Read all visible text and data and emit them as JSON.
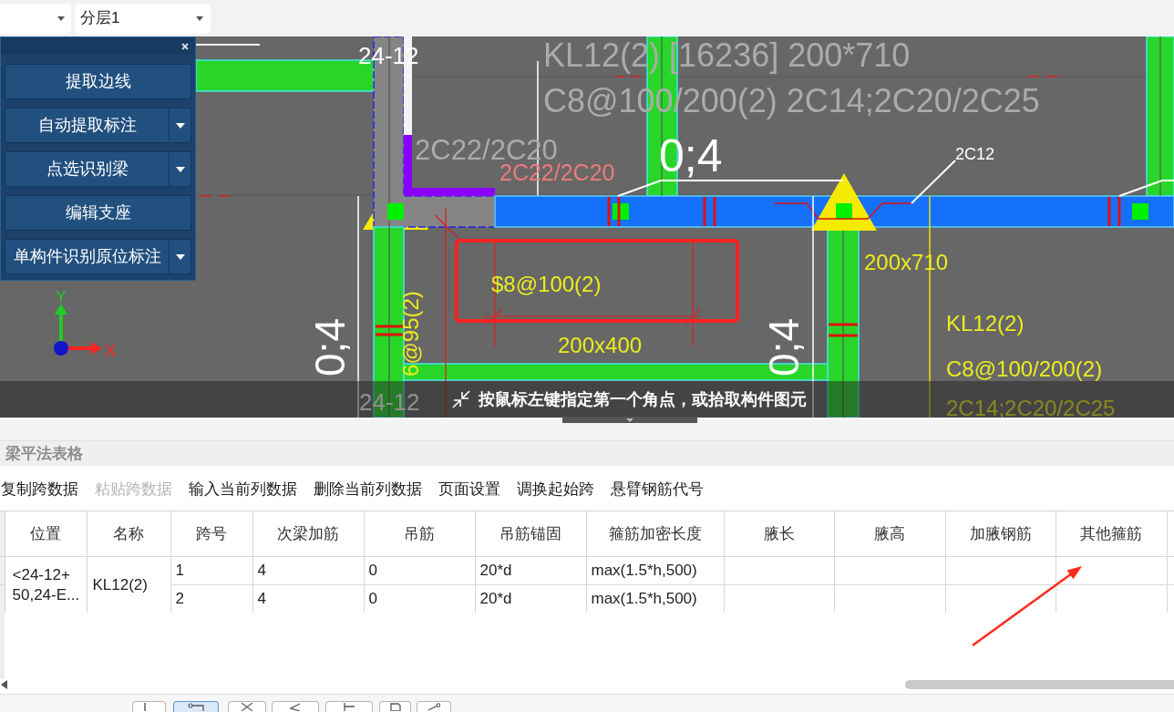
{
  "top_bar": {
    "layer_dropdown": "分层1"
  },
  "recognition_panel": {
    "buttons": [
      {
        "label": "提取边线",
        "has_menu": false
      },
      {
        "label": "自动提取标注",
        "has_menu": true
      },
      {
        "label": "点选识别梁",
        "has_menu": true
      },
      {
        "label": "编辑支座",
        "has_menu": false
      },
      {
        "label": "单构件识别原位标注",
        "has_menu": true
      }
    ]
  },
  "canvas": {
    "texts": [
      {
        "kind": "axis_number",
        "text": "24-12"
      },
      {
        "kind": "beam_spec",
        "text": "KL12(2) [16236] 200*710"
      },
      {
        "kind": "beam_spec",
        "text": "C8@100/200(2) 2C14;2C20/2C25"
      },
      {
        "kind": "rebar_spec",
        "text": "2C22/2C20"
      },
      {
        "kind": "span_mark",
        "text": "0;4"
      },
      {
        "kind": "leader_note",
        "text": "2C12"
      },
      {
        "kind": "rebar_mark",
        "text": "2C22/2C20"
      },
      {
        "kind": "cad_note",
        "text": "200x710"
      },
      {
        "kind": "cad_note",
        "text": "$8@100(2)"
      },
      {
        "kind": "cad_note_vertical",
        "text": "6@95(2)"
      },
      {
        "kind": "cad_note",
        "text": "KL12(2)"
      },
      {
        "kind": "span_mark_vertical",
        "text": "0;4"
      },
      {
        "kind": "cad_note",
        "text": "200x400"
      },
      {
        "kind": "span_mark_vertical",
        "text": "0;4"
      },
      {
        "kind": "cad_note",
        "text": "C8@100/200(2)"
      },
      {
        "kind": "axis_number",
        "text": "24-12"
      },
      {
        "kind": "cad_note",
        "text": "2C14;2C20/2C25"
      }
    ],
    "axis_indicator": {
      "x_label": "X",
      "y_label": "Y"
    }
  },
  "status_prompt": "按鼠标左键指定第一个角点，或拾取构件图元",
  "table_panel": {
    "title": "梁平法表格",
    "actions": [
      {
        "label": "复制跨数据",
        "disabled": false
      },
      {
        "label": "粘贴跨数据",
        "disabled": true
      },
      {
        "label": "输入当前列数据",
        "disabled": false
      },
      {
        "label": "删除当前列数据",
        "disabled": false
      },
      {
        "label": "页面设置",
        "disabled": false
      },
      {
        "label": "调换起始跨",
        "disabled": false
      },
      {
        "label": "悬臂钢筋代号",
        "disabled": false
      }
    ],
    "table": {
      "columns": [
        "位置",
        "名称",
        "跨号",
        "次梁加筋",
        "吊筋",
        "吊筋锚固",
        "箍筋加密长度",
        "腋长",
        "腋高",
        "加腋钢筋",
        "其他箍筋"
      ],
      "beams": [
        {
          "position_lines": [
            "<24-12+",
            "50,24-E..."
          ],
          "name": "KL12(2)",
          "spans": [
            [
              "1",
              "4",
              "0",
              "20*d",
              "max(1.5*h,500)"
            ],
            [
              "2",
              "4",
              "0",
              "20*d",
              "max(1.5*h,500)"
            ]
          ]
        }
      ]
    }
  },
  "bottom_tools": [
    {
      "selected": false
    },
    {
      "selected": true
    },
    {
      "selected": false
    },
    {
      "selected": false
    },
    {
      "selected": false
    },
    {
      "selected": false
    },
    {
      "selected": false
    }
  ]
}
